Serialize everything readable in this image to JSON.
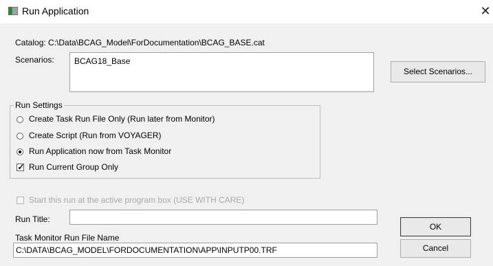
{
  "window": {
    "title": "Run Application",
    "close_glyph": "✕"
  },
  "catalog": {
    "text": "Catalog: C:\\Data\\BCAG_Model\\ForDocumentation\\BCAG_BASE.cat"
  },
  "scenarios": {
    "label": "Scenarios:",
    "value": "BCAG18_Base",
    "select_button": "Select Scenarios..."
  },
  "run_settings": {
    "legend": "Run Settings",
    "options": [
      {
        "label": "Create Task Run File Only (Run later from Monitor)",
        "selected": false
      },
      {
        "label": "Create Script (Run from VOYAGER)",
        "selected": false
      },
      {
        "label": "Run Application now from Task Monitor",
        "selected": true
      }
    ],
    "current_group": {
      "label": "Run Current Group Only",
      "checked": true,
      "check_glyph": "✓"
    }
  },
  "start_active": {
    "label": "Start this run at the active program box (USE WITH CARE)",
    "checked": false,
    "enabled": false
  },
  "run_title": {
    "label": "Run Title:",
    "value": ""
  },
  "task_monitor": {
    "label": "Task Monitor Run File Name",
    "value": "C:\\DATA\\BCAG_MODEL\\FORDOCUMENTATION\\APP\\INPUTP00.TRF"
  },
  "buttons": {
    "ok": "OK",
    "cancel": "Cancel"
  }
}
